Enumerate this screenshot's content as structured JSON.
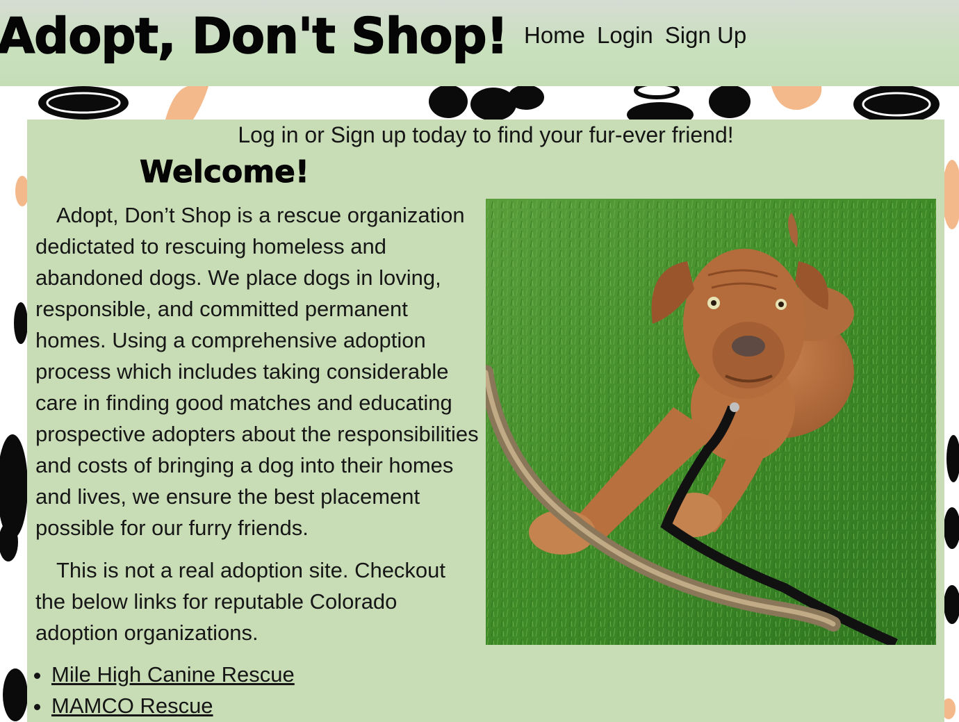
{
  "header": {
    "brand": "Adopt, Don't Shop!",
    "nav": {
      "home": "Home",
      "login": "Login",
      "signup": "Sign Up"
    }
  },
  "main": {
    "tagline": "Log in or Sign up today to find your fur-ever friend!",
    "welcome": "Welcome!",
    "intro": "Adopt, Don’t Shop is a rescue organization dedictated to rescuing homeless and abandoned dogs. We place dogs in loving, responsible, and committed permanent homes. Using a comprehensive adoption process which includes taking considerable care in finding good matches and educating prospective adopters about the responsibilities and costs of bringing a dog into their homes and lives, we ensure the best placement possible for our furry friends.",
    "disclaimer": "This is not a real adoption site. Checkout the below links for reputable Colorado adoption organizations.",
    "links": [
      {
        "label": "Mile High Canine Rescue"
      },
      {
        "label": "MAMCO Rescue"
      }
    ]
  },
  "colors": {
    "header_bg": "#c8e0bc",
    "panel_bg": "#c8ddb6",
    "paw_black": "#0a0a0a",
    "paw_orange": "#f4b98a",
    "grass": "#3f8a28",
    "dog": "#b8693a"
  }
}
